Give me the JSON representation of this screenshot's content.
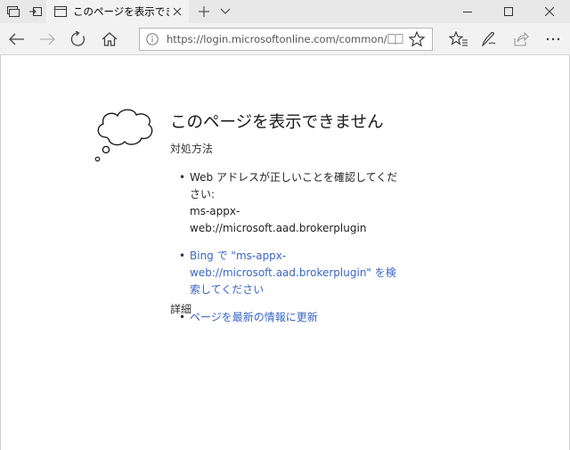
{
  "tab": {
    "title": "このページを表示できません"
  },
  "address_bar": {
    "url": "https://login.microsoftonline.com/common/reproces"
  },
  "error_page": {
    "title": "このページを表示できません",
    "fix_heading": "対処方法",
    "suggestion1_line1": "Web アドレスが正しいことを確認してください:",
    "suggestion1_line2": "ms-appx-web://microsoft.aad.brokerplugin",
    "suggestion2_link": "Bing で \"ms-appx-web://microsoft.aad.brokerplugin\" を検索してください",
    "suggestion3_link": "ページを最新の情報に更新",
    "details": "詳細"
  },
  "icons": {
    "tab_preview": "tab-preview-icon",
    "set_aside_tabs": "set-aside-tabs-icon",
    "page_favicon": "page-icon",
    "close_tab": "close-icon",
    "new_tab": "plus-icon",
    "tab_list": "chevron-down-icon",
    "minimize": "minimize-icon",
    "maximize": "maximize-icon",
    "close_window": "close-icon",
    "back": "back-arrow-icon",
    "forward": "forward-arrow-icon",
    "refresh": "refresh-icon",
    "home": "home-icon",
    "info": "info-icon",
    "reading_view": "book-icon",
    "favorite": "star-icon",
    "favorites_hub": "star-list-icon",
    "web_note": "pen-icon",
    "share": "share-icon",
    "error_cloud": "thought-cloud-icon"
  },
  "colors": {
    "link": "#3a66c4",
    "titlebar": "#e8e8e8",
    "toolbar": "#f2f2f2"
  }
}
